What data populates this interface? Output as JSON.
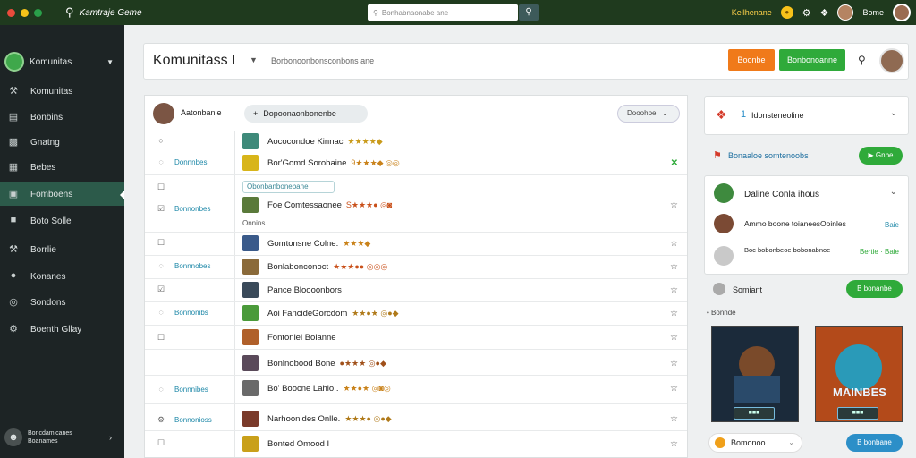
{
  "app": {
    "title": "Kamtraje Geme"
  },
  "colors": {
    "topbar": "#1f3a1e",
    "sidebar": "#1d2425",
    "accent_green": "#2faa3a",
    "accent_orange": "#f07a1a",
    "accent_blue": "#2c8fc8"
  },
  "topbar": {
    "search_placeholder": "Bonhabnaonabe ane",
    "status_text": "Kellhenane",
    "user_name": "Bome"
  },
  "sidebar": {
    "header": "Komunitas",
    "items": [
      {
        "label": "Komunitas",
        "icon": "wrench-icon"
      },
      {
        "label": "Bonbins",
        "icon": "clipboard-icon"
      },
      {
        "label": "Gnatng",
        "icon": "chart-icon"
      },
      {
        "label": "Bebes",
        "icon": "grid-icon"
      },
      {
        "label": "Fomboens",
        "icon": "folder-icon"
      },
      {
        "label": "Boto Solle",
        "icon": "box-icon"
      },
      {
        "label": "Borrlie",
        "icon": "tools-icon"
      },
      {
        "label": "Konanes",
        "icon": "chat-icon"
      },
      {
        "label": "Sondons",
        "icon": "coin-icon"
      },
      {
        "label": "Boenth Gllay",
        "icon": "gear-icon"
      }
    ],
    "footer": {
      "line1": "Boncdamicanes",
      "line2": "Boanames"
    }
  },
  "header": {
    "title": "Komunitass",
    "cursor": "I",
    "subtitle": "Borbonoonbonsconbons ane",
    "orange_button": "Boonbe",
    "green_button": "Bonbonoanne"
  },
  "list": {
    "user": "Aatonbanie",
    "add_button": "Dopoonaonbonenbe",
    "filter": "Dooohpe",
    "tag": "Obonbanbonebane",
    "subtext": "Onnins",
    "groups": [
      "Donnnbes",
      "Bonnonbes",
      "Bonnnobes",
      "Bonnonibs",
      "Bonnnibes",
      "Bonnonioss"
    ],
    "rows": [
      {
        "title": "Aococondoe Kinnac",
        "badges": "★★★★◆",
        "action": ""
      },
      {
        "title": "Bor'Gomd Sorobaine",
        "badges": "9★★★◆ ◎◎",
        "action": "✕"
      },
      {
        "title": "Foe Comtessaonee",
        "badges": "S★★★● ◎◙",
        "action": "☆"
      },
      {
        "title": "Gomtonsne Colne.",
        "badges": "★★★◆",
        "action": "☆"
      },
      {
        "title": "Bonlabonconoct",
        "badges": "★★★●● ◎◎◎",
        "action": "☆"
      },
      {
        "title": "Pance Bloooonbors",
        "badges": "",
        "action": "☆"
      },
      {
        "title": "Aoi FancideGorcdom",
        "badges": "★★●★ ◎●◆",
        "action": "☆"
      },
      {
        "title": "Fontonlel Boianne",
        "badges": "",
        "action": "☆"
      },
      {
        "title": "Bonlnobood Bone",
        "badges": "●★★★ ◎●◆",
        "action": "☆"
      },
      {
        "title": "Bo' Boocne Lahlo..",
        "badges": "★★●★ ◎◙◎",
        "action": "☆"
      },
      {
        "title": "Narhoonides Onlle.",
        "badges": "★★★● ◎●◆",
        "action": "☆"
      },
      {
        "title": "Bonted Omood I",
        "badges": "",
        "action": "☆"
      }
    ]
  },
  "right_panel": {
    "card1_title": "Idonsteneoline",
    "card1_num": "1",
    "promo_text": "Bonaaloe somtenoobs",
    "promo_button": "Gnbe",
    "online_title": "Daline Conla ihous",
    "friends": [
      {
        "name": "Ammo boone toianeesOoinles",
        "link": "Baie"
      },
      {
        "name": "Boc bobonbeoe bobonabnoe",
        "link": "Bertie · Baie"
      }
    ],
    "summit": "Somiant",
    "summit_button": "B bonanbe",
    "section_label": "Bonnde",
    "poster2_label": "MAINBES",
    "bottom_label": "Bomonoo",
    "bottom_button": "B bonbane"
  }
}
